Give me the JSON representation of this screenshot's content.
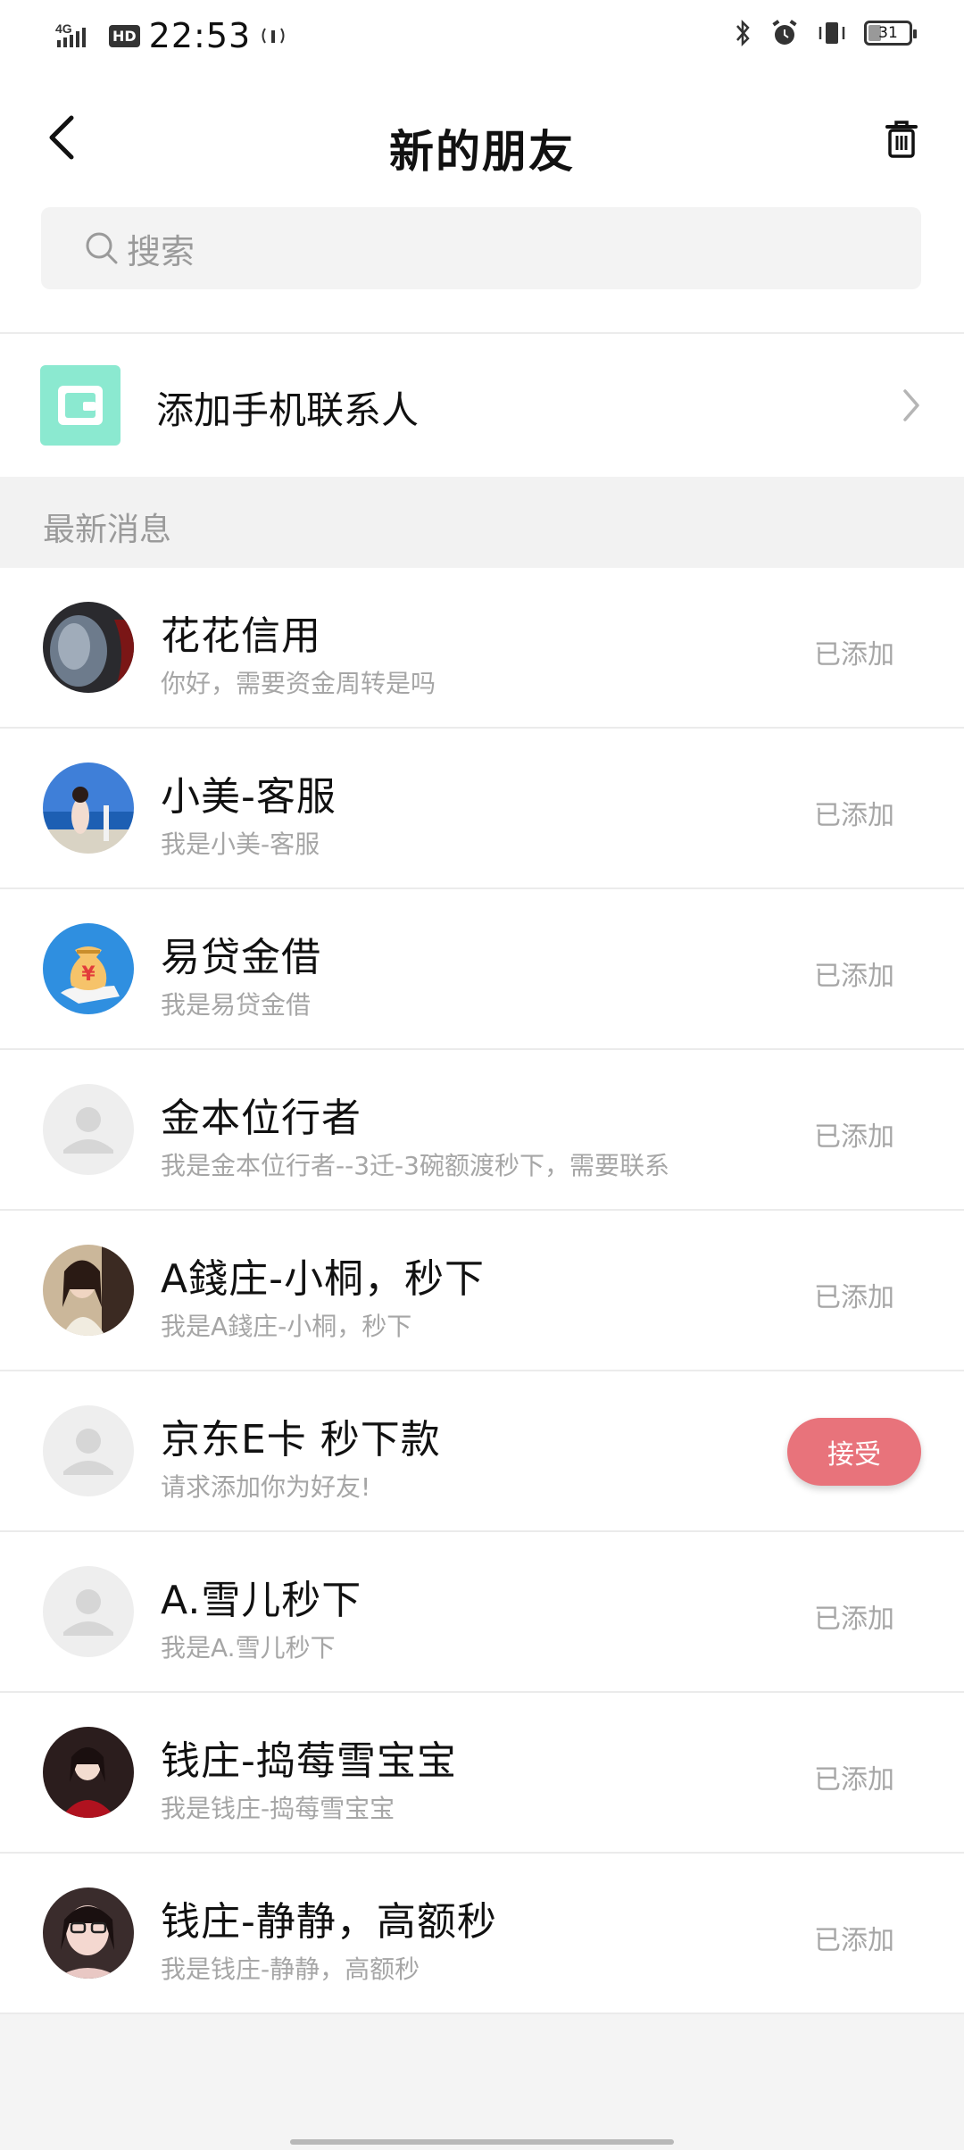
{
  "status_bar": {
    "network": "4G",
    "hd": "HD",
    "time": "22:53",
    "battery": "31"
  },
  "header": {
    "title": "新的朋友"
  },
  "search": {
    "placeholder": "搜索"
  },
  "add_contact": {
    "label": "添加手机联系人"
  },
  "section": {
    "title": "最新消息"
  },
  "friends": [
    {
      "name": "花花信用",
      "message": "你好，需要资金周转是吗",
      "status": "已添加",
      "avatar": "photo-dark"
    },
    {
      "name": "小美-客服",
      "message": "我是小美-客服",
      "status": "已添加",
      "avatar": "photo-beach"
    },
    {
      "name": "易贷金借",
      "message": "我是易贷金借",
      "status": "已添加",
      "avatar": "money-bag-icon"
    },
    {
      "name": "金本位行者",
      "message": "我是金本位行者--3迁-3碗额渡秒下，需要联系",
      "status": "已添加",
      "avatar": "default-user-icon"
    },
    {
      "name": "A錢庄-小桐，秒下",
      "message": "我是A錢庄-小桐，秒下",
      "status": "已添加",
      "avatar": "photo-woman"
    },
    {
      "name": "京东E卡 秒下款",
      "message": "请求添加你为好友!",
      "action": "接受",
      "avatar": "default-user-icon"
    },
    {
      "name": "A.雪儿秒下",
      "message": "我是A.雪儿秒下",
      "status": "已添加",
      "avatar": "default-user-icon"
    },
    {
      "name": "钱庄-捣莓雪宝宝",
      "message": "我是钱庄-捣莓雪宝宝",
      "status": "已添加",
      "avatar": "photo-woman-red"
    },
    {
      "name": "钱庄-静静，高额秒",
      "message": "我是钱庄-静静，高额秒",
      "status": "已添加",
      "avatar": "photo-woman-glasses"
    }
  ],
  "colors": {
    "accent": "#e8737b",
    "add_icon_bg": "#8be9d0"
  }
}
